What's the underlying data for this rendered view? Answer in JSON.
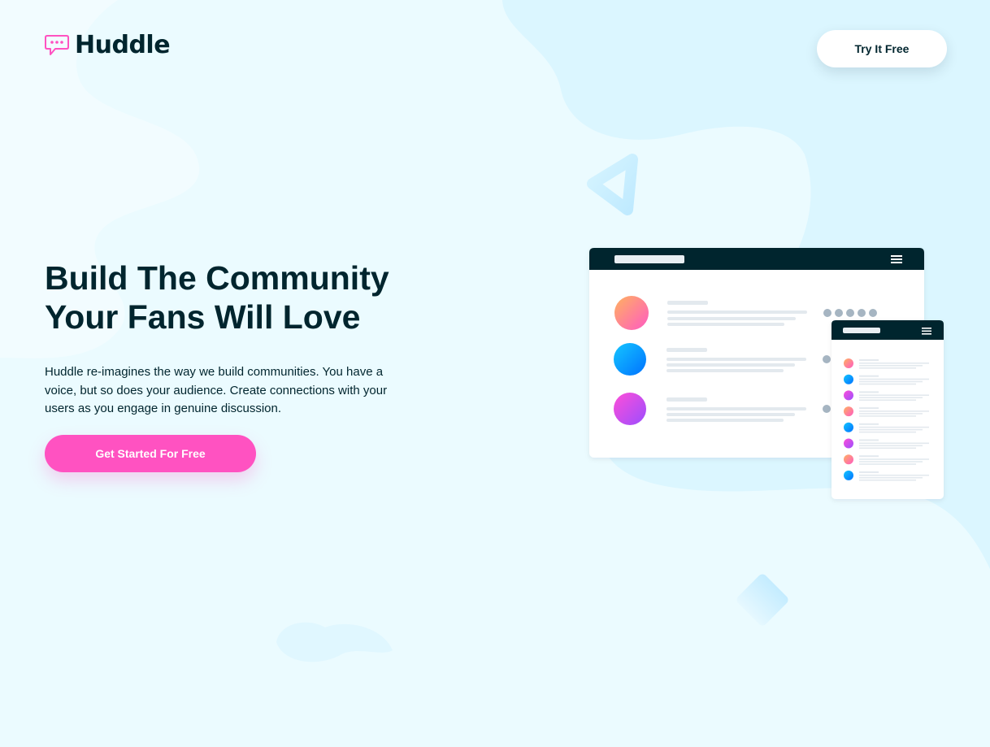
{
  "brand": {
    "name": "Huddle",
    "logo_icon": "chat-bubble-icon"
  },
  "header": {
    "cta_label": "Try It Free"
  },
  "hero": {
    "title_lines": [
      "Build The Community",
      "Your Fans Will Love"
    ],
    "description": "Huddle re-imagines the way we build communities. You have a voice, but so does your audience. Create connections with your users as you engage in genuine discussion.",
    "cta_label": "Get Started For Free"
  },
  "colors": {
    "background": "#ebfbff",
    "primary_text": "#00252e",
    "accent_pink": "#ff52c1",
    "button_white": "#ffffff"
  },
  "illustration": {
    "desktop_window": {
      "menu_icon": "hamburger-menu-icon",
      "rows": 3
    },
    "mobile_window": {
      "menu_icon": "hamburger-menu-icon",
      "rows": 8
    }
  }
}
